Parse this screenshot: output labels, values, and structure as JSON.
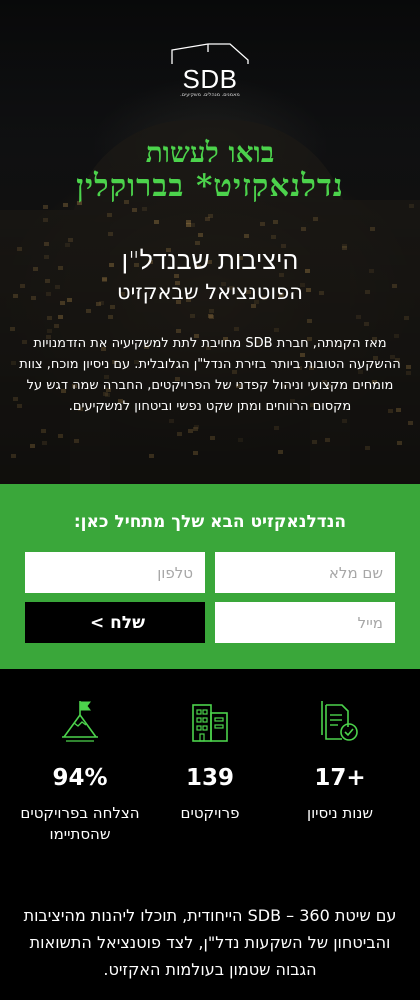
{
  "brand": {
    "logo_text": "SDB",
    "tagline": "מאמנים. מנהלים. משקיעים."
  },
  "hero": {
    "promo_line1": "בואו לעשות",
    "promo_line2": "נדלנאקזיט* בברוקלין",
    "headline1": "היציבות שבנדל\"ן",
    "headline2": "הפוטנציאל שבאקזיט",
    "intro": "מאז הקמתה, חברת SDB מחויבת לתת למשקיעיה את הזדמנויות ההשקעה הטובות ביותר בזירת הנדל\"ן הגלובלית. עם ניסיון מוכח, צוות מומחים מקצועי וניהול קפדני של הפרויקטים, החברה שמה דגש על מקסום הרווחים ומתן שקט נפשי וביטחון למשקיעים."
  },
  "form": {
    "title": "הנדלנאקזיט הבא שלך מתחיל כאן:",
    "name_placeholder": "שם מלא",
    "phone_placeholder": "טלפון",
    "email_placeholder": "מייל",
    "submit_label": "שלח >"
  },
  "stats": [
    {
      "icon": "documents-check-icon",
      "value": "+17",
      "label": "שנות ניסיון"
    },
    {
      "icon": "buildings-icon",
      "value": "139",
      "label": "פרויקטים"
    },
    {
      "icon": "mountain-flag-icon",
      "value": "94%",
      "label": "הצלחה בפרויקטים שהסתיימו"
    }
  ],
  "bottom_text": "עם שיטת SDB – 360 הייחודית, תוכלו ליהנות מהיציבות והביטחון של השקעות נדל\"ן, לצד פוטנציאל התשואות הגבוה שטמון בעולמות האקזיט.",
  "colors": {
    "accent_green": "#3aa73a",
    "promo_green": "#4cd34c",
    "icon_green": "#4cd34c"
  }
}
